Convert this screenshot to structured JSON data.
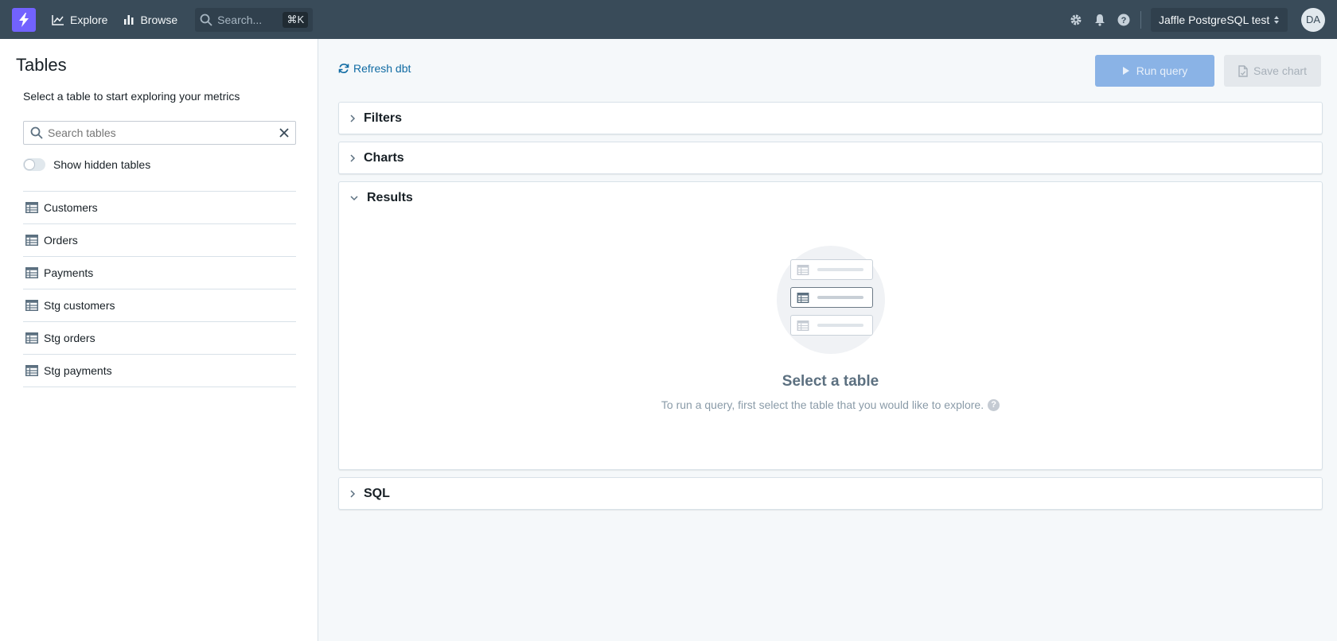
{
  "navbar": {
    "explore_label": "Explore",
    "browse_label": "Browse",
    "search_placeholder": "Search...",
    "search_shortcut": "⌘K",
    "project_name": "Jaffle PostgreSQL test",
    "avatar_initials": "DA"
  },
  "sidebar": {
    "title": "Tables",
    "description": "Select a table to start exploring your metrics",
    "search_placeholder": "Search tables",
    "show_hidden_label": "Show hidden tables",
    "show_hidden_on": false,
    "tables": [
      {
        "label": "Customers"
      },
      {
        "label": "Orders"
      },
      {
        "label": "Payments"
      },
      {
        "label": "Stg customers"
      },
      {
        "label": "Stg orders"
      },
      {
        "label": "Stg payments"
      }
    ]
  },
  "main": {
    "refresh_label": "Refresh dbt",
    "run_query_label": "Run query",
    "save_chart_label": "Save chart",
    "sections": {
      "filters": "Filters",
      "charts": "Charts",
      "results": "Results",
      "sql": "SQL"
    },
    "empty_state": {
      "title": "Select a table",
      "description": "To run a query, first select the table that you would like to explore.",
      "help_glyph": "?"
    }
  },
  "colors": {
    "navbar": "#394b59",
    "brand": "#7262ff",
    "link": "#106ba3",
    "run_button_disabled": "#8ab3e6"
  }
}
